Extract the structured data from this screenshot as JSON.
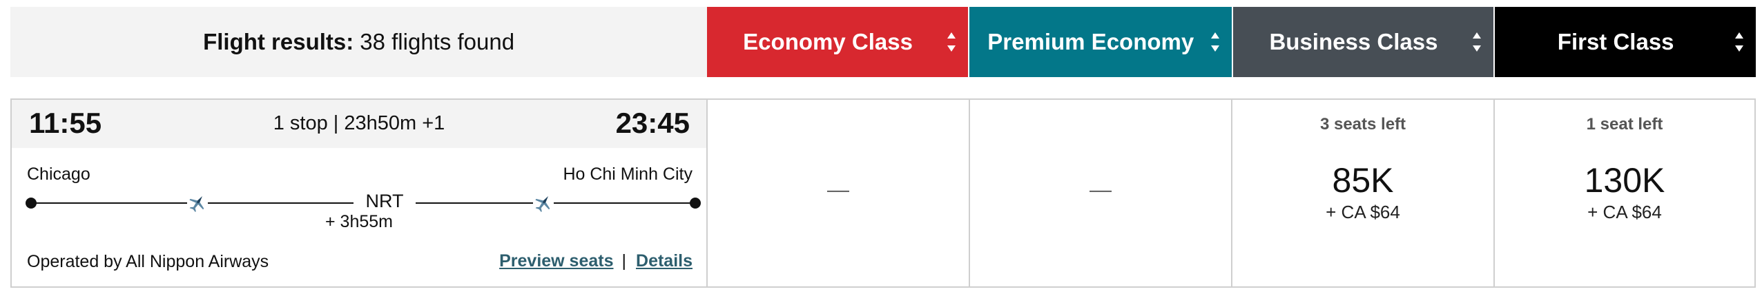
{
  "results": {
    "label": "Flight results:",
    "count_text": "38 flights found"
  },
  "cabin_tabs": [
    {
      "label": "Economy Class",
      "color": "#d8282f"
    },
    {
      "label": "Premium Economy",
      "color": "#037789"
    },
    {
      "label": "Business Class",
      "color": "#474e55"
    },
    {
      "label": "First Class",
      "color": "#000000"
    }
  ],
  "flight": {
    "departure_time": "11:55",
    "arrival_time": "23:45",
    "stops_duration": "1 stop | 23h50m +1",
    "origin": "Chicago",
    "destination": "Ho Chi Minh City",
    "stop_code": "NRT",
    "layover": "+ 3h55m",
    "operated_by": "Operated by All Nippon Airways",
    "preview_seats_label": "Preview seats",
    "separator": "|",
    "details_label": "Details",
    "icons": [
      "plane-icon",
      "plane-icon"
    ]
  },
  "fares": {
    "economy": {
      "unavailable_text": "—"
    },
    "premium": {
      "unavailable_text": "—"
    },
    "business": {
      "seats_left": "3 seats left",
      "points": "85K",
      "taxes": "+ CA $64"
    },
    "first": {
      "seats_left": "1 seat left",
      "points": "130K",
      "taxes": "+ CA $64"
    }
  },
  "colors": {
    "link": "#2d5e6e",
    "summary_bg": "#f3f3f3",
    "border": "#cfcfcf"
  }
}
